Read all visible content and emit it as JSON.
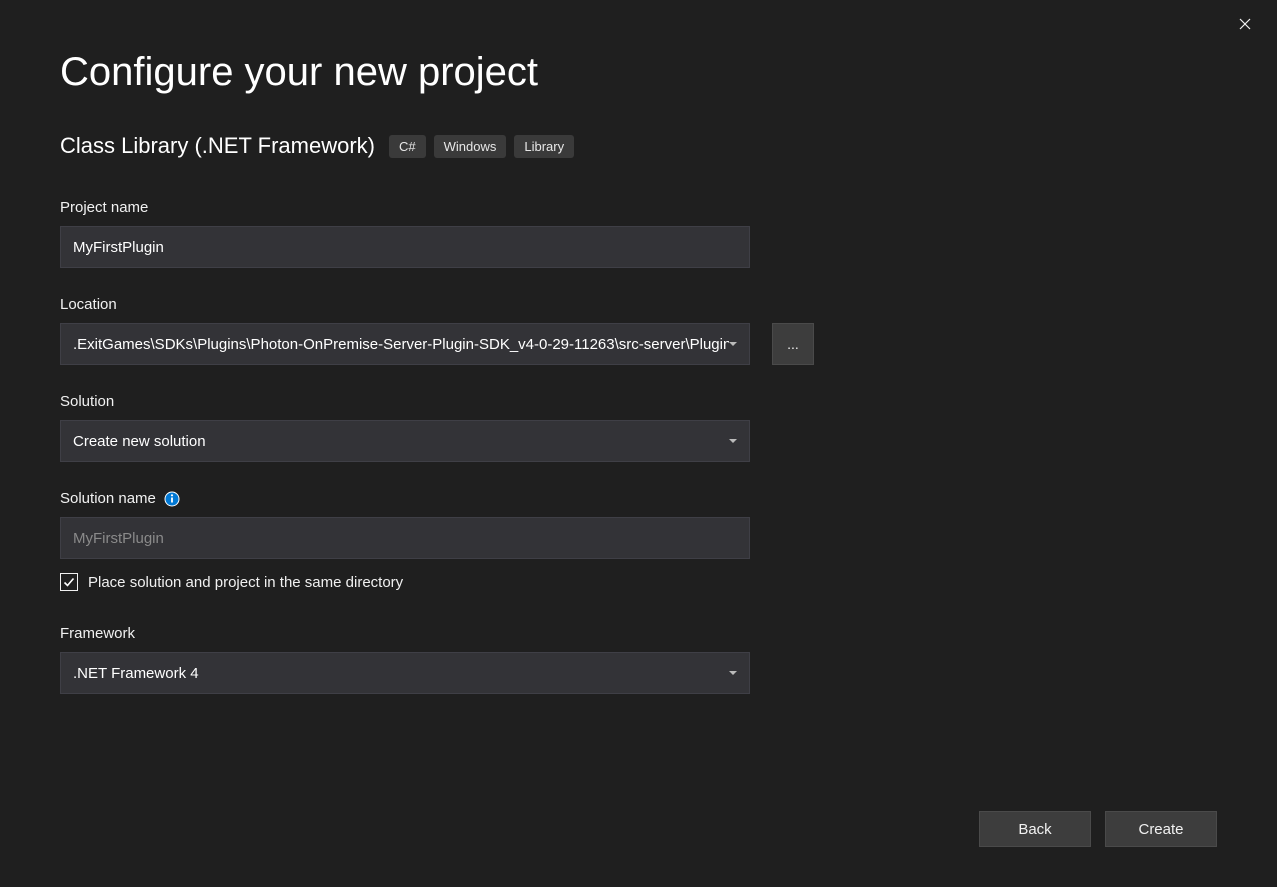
{
  "page_title": "Configure your new project",
  "project_type": "Class Library (.NET Framework)",
  "tags": [
    "C#",
    "Windows",
    "Library"
  ],
  "fields": {
    "project_name": {
      "label": "Project name",
      "value": "MyFirstPlugin"
    },
    "location": {
      "label": "Location",
      "value": ".ExitGames\\SDKs\\Plugins\\Photon-OnPremise-Server-Plugin-SDK_v4-0-29-11263\\src-server\\Plugins",
      "browse_label": "..."
    },
    "solution": {
      "label": "Solution",
      "value": "Create new solution"
    },
    "solution_name": {
      "label": "Solution name",
      "placeholder": "MyFirstPlugin"
    },
    "same_directory": {
      "label": "Place solution and project in the same directory",
      "checked": true
    },
    "framework": {
      "label": "Framework",
      "value": ".NET Framework 4"
    }
  },
  "footer": {
    "back": "Back",
    "create": "Create"
  }
}
